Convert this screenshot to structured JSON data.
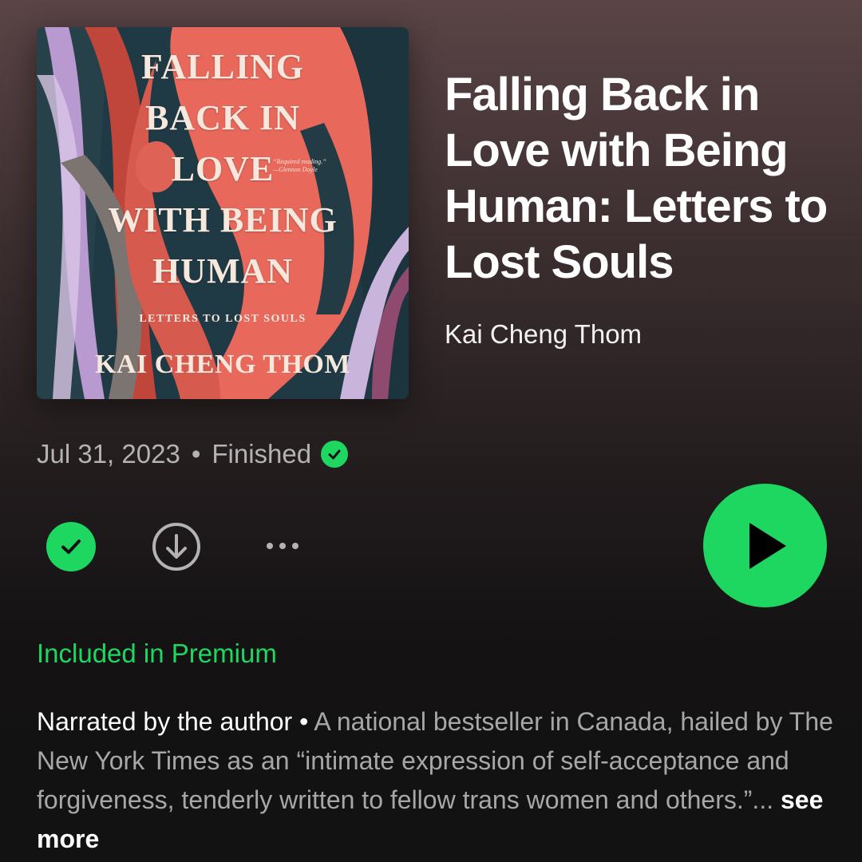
{
  "audiobook": {
    "cover": {
      "title_lines": [
        "FALLING",
        "BACK IN",
        "LOVE",
        "WITH BEING",
        "HUMAN"
      ],
      "subtitle": "LETTERS TO LOST SOULS",
      "author": "KAI CHENG THOM",
      "quote": "“Required reading.”",
      "quote_attribution": "—Glennon Doyle"
    },
    "title": "Falling Back in Love with Being Human: Letters to Lost Souls",
    "author": "Kai Cheng Thom",
    "date": "Jul 31, 2023",
    "separator": "•",
    "status": "Finished",
    "availability": "Included in Premium",
    "description": {
      "lead": "Narrated by the author",
      "separator": " • ",
      "body": "A national bestseller in Canada, hailed by The New York Times as an “intimate expression of self-acceptance and forgiveness, tenderly written to fellow trans women and others.”...",
      "see_more": "see more"
    }
  },
  "icons": {
    "saved": "check-circle-icon",
    "download": "download-icon",
    "more": "more-horizontal-icon",
    "play": "play-icon",
    "finished": "check-circle-icon"
  },
  "colors": {
    "accent": "#1ed760",
    "text_primary": "#ffffff",
    "text_secondary": "#b3b3b3",
    "cover_figure": "#e8695c"
  }
}
